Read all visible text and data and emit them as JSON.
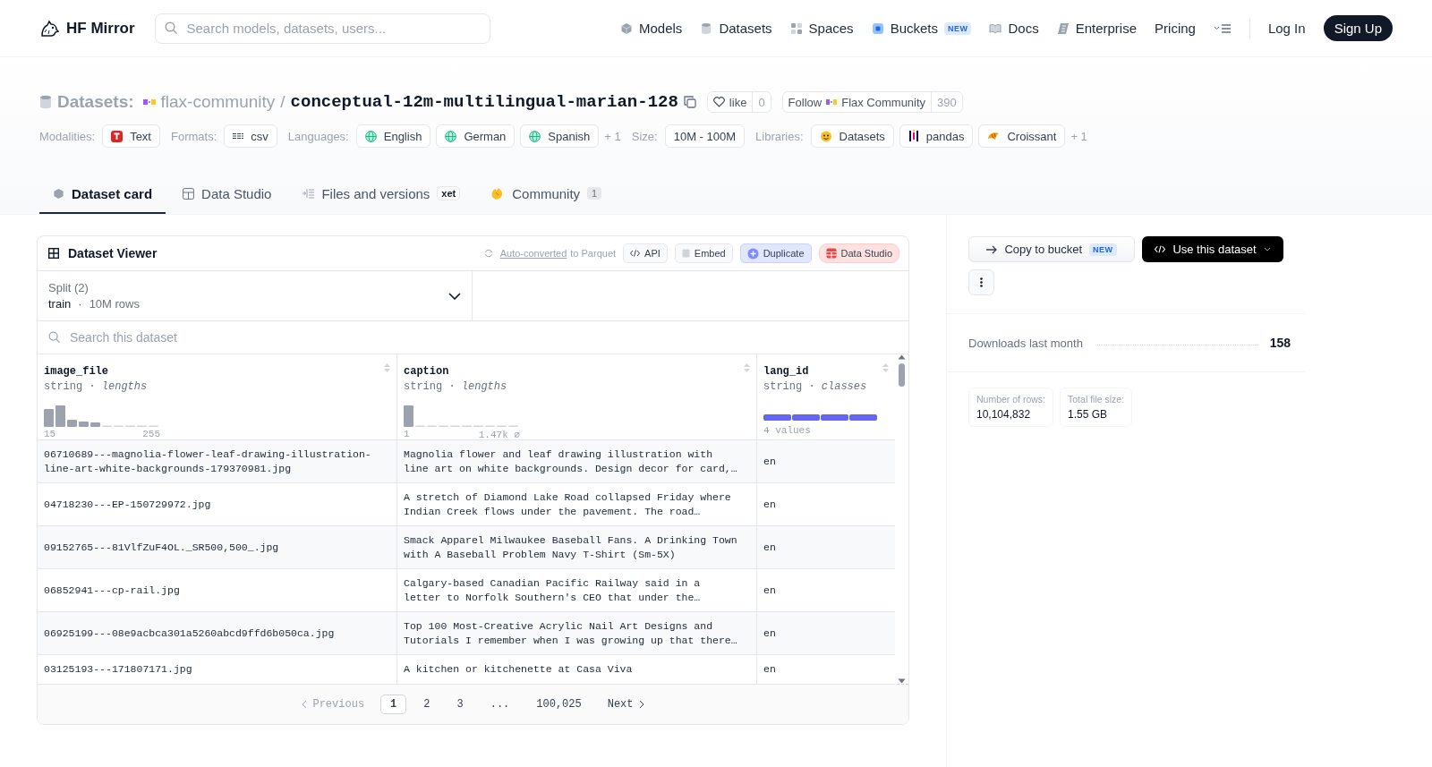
{
  "header": {
    "brand": "HF Mirror",
    "search": {
      "placeholder": "Search models, datasets, users..."
    },
    "nav": [
      {
        "label": "Models"
      },
      {
        "label": "Datasets"
      },
      {
        "label": "Spaces"
      },
      {
        "label": "Buckets",
        "badge": "NEW"
      },
      {
        "label": "Docs"
      },
      {
        "label": "Enterprise"
      },
      {
        "label": "Pricing"
      }
    ],
    "login": "Log In",
    "signup": "Sign Up"
  },
  "repo": {
    "type": "Datasets:",
    "owner": "flax-community",
    "separator": "/",
    "name": "conceptual-12m-multilingual-marian-128",
    "like": {
      "label": "like",
      "count": "0"
    },
    "follow": {
      "label": "Follow",
      "org": "Flax Community",
      "count": "390"
    }
  },
  "tag_groups": [
    {
      "label": "Modalities:",
      "items": [
        "Text"
      ]
    },
    {
      "label": "Formats:",
      "items": [
        "csv"
      ]
    },
    {
      "label": "Languages:",
      "items": [
        "English",
        "German",
        "Spanish"
      ],
      "more": "+ 1"
    },
    {
      "label": "Size:",
      "items": [
        "10M - 100M"
      ]
    },
    {
      "label": "Libraries:",
      "items": [
        "Datasets",
        "pandas",
        "Croissant"
      ],
      "more": "+ 1"
    }
  ],
  "tabs": [
    {
      "label": "Dataset card",
      "selected": true
    },
    {
      "label": "Data Studio",
      "selected": false
    },
    {
      "label": "Files and versions",
      "badge": "xet",
      "selected": false
    },
    {
      "label": "Community",
      "count": "1",
      "selected": false
    }
  ],
  "viewer": {
    "title": "Dataset Viewer",
    "conversion": {
      "link": "Auto-converted",
      "text": " to Parquet"
    },
    "actions": [
      {
        "label": "API",
        "kind": "plain"
      },
      {
        "label": "Embed",
        "kind": "plain"
      },
      {
        "label": "Duplicate",
        "kind": "duplicate"
      },
      {
        "label": "Data Studio",
        "kind": "studio"
      }
    ],
    "split": {
      "label": "Split (2)",
      "value": "train",
      "separator": "·",
      "rows": "10M rows"
    },
    "search": {
      "placeholder": "Search this dataset"
    },
    "columns": [
      {
        "name": "image_file",
        "type": "string · *lengths*",
        "kind": "lengths",
        "min": "15",
        "max": "255"
      },
      {
        "name": "caption",
        "type": "string · *lengths*",
        "kind": "lengths",
        "min": "1",
        "max": "1.47k",
        "null_mark": "⌀"
      },
      {
        "name": "lang_id",
        "type": "string · *classes*",
        "kind": "classes",
        "summary": "4 values"
      }
    ],
    "rows": [
      [
        "06710689---magnolia-flower-leaf-drawing-illustration-\nline-art-white-backgrounds-179370981.jpg",
        "Magnolia flower and leaf drawing illustration with\nline art on white backgrounds. Design decor for card,…",
        "en"
      ],
      [
        "04718230---EP-150729972.jpg",
        "A stretch of Diamond Lake Road collapsed Friday where\nIndian Creek flows under the pavement. The road…",
        "en"
      ],
      [
        "09152765---81VlfZuF4OL._SR500,500_.jpg",
        "Smack Apparel Milwaukee Baseball Fans. A Drinking Town\nwith A Baseball Problem Navy T-Shirt (Sm-5X)",
        "en"
      ],
      [
        "06852941---cp-rail.jpg",
        "Calgary-based Canadian Pacific Railway said in a\nletter to Norfolk Southern's CEO that under the…",
        "en"
      ],
      [
        "06925199---08e9acbca301a5260abcd9ffd6b050ca.jpg",
        "Top 100 Most-Creative Acrylic Nail Art Designs and\nTutorials I remember when I was growing up that there…",
        "en"
      ],
      [
        "03125193---171807171.jpg",
        "A kitchen or kitchenette at Casa Viva",
        "en"
      ]
    ],
    "pagination": {
      "previous": {
        "label": "Previous",
        "disabled": true
      },
      "pages": [
        {
          "label": "1",
          "selected": true
        },
        {
          "label": "2",
          "selected": false
        },
        {
          "label": "3",
          "selected": false
        },
        {
          "label": "...",
          "selected": false
        },
        {
          "label": "100,025",
          "selected": false
        }
      ],
      "next": {
        "label": "Next",
        "disabled": false
      }
    }
  },
  "sidebar": {
    "copy": {
      "label": "Copy to bucket",
      "badge": "NEW"
    },
    "use": "Use this dataset",
    "downloads": {
      "label": "Downloads last month",
      "value": "158"
    },
    "stats": [
      {
        "label": "Number of rows:",
        "value": "10,104,832"
      },
      {
        "label": "Total file size:",
        "value": "1.55 GB"
      }
    ]
  }
}
